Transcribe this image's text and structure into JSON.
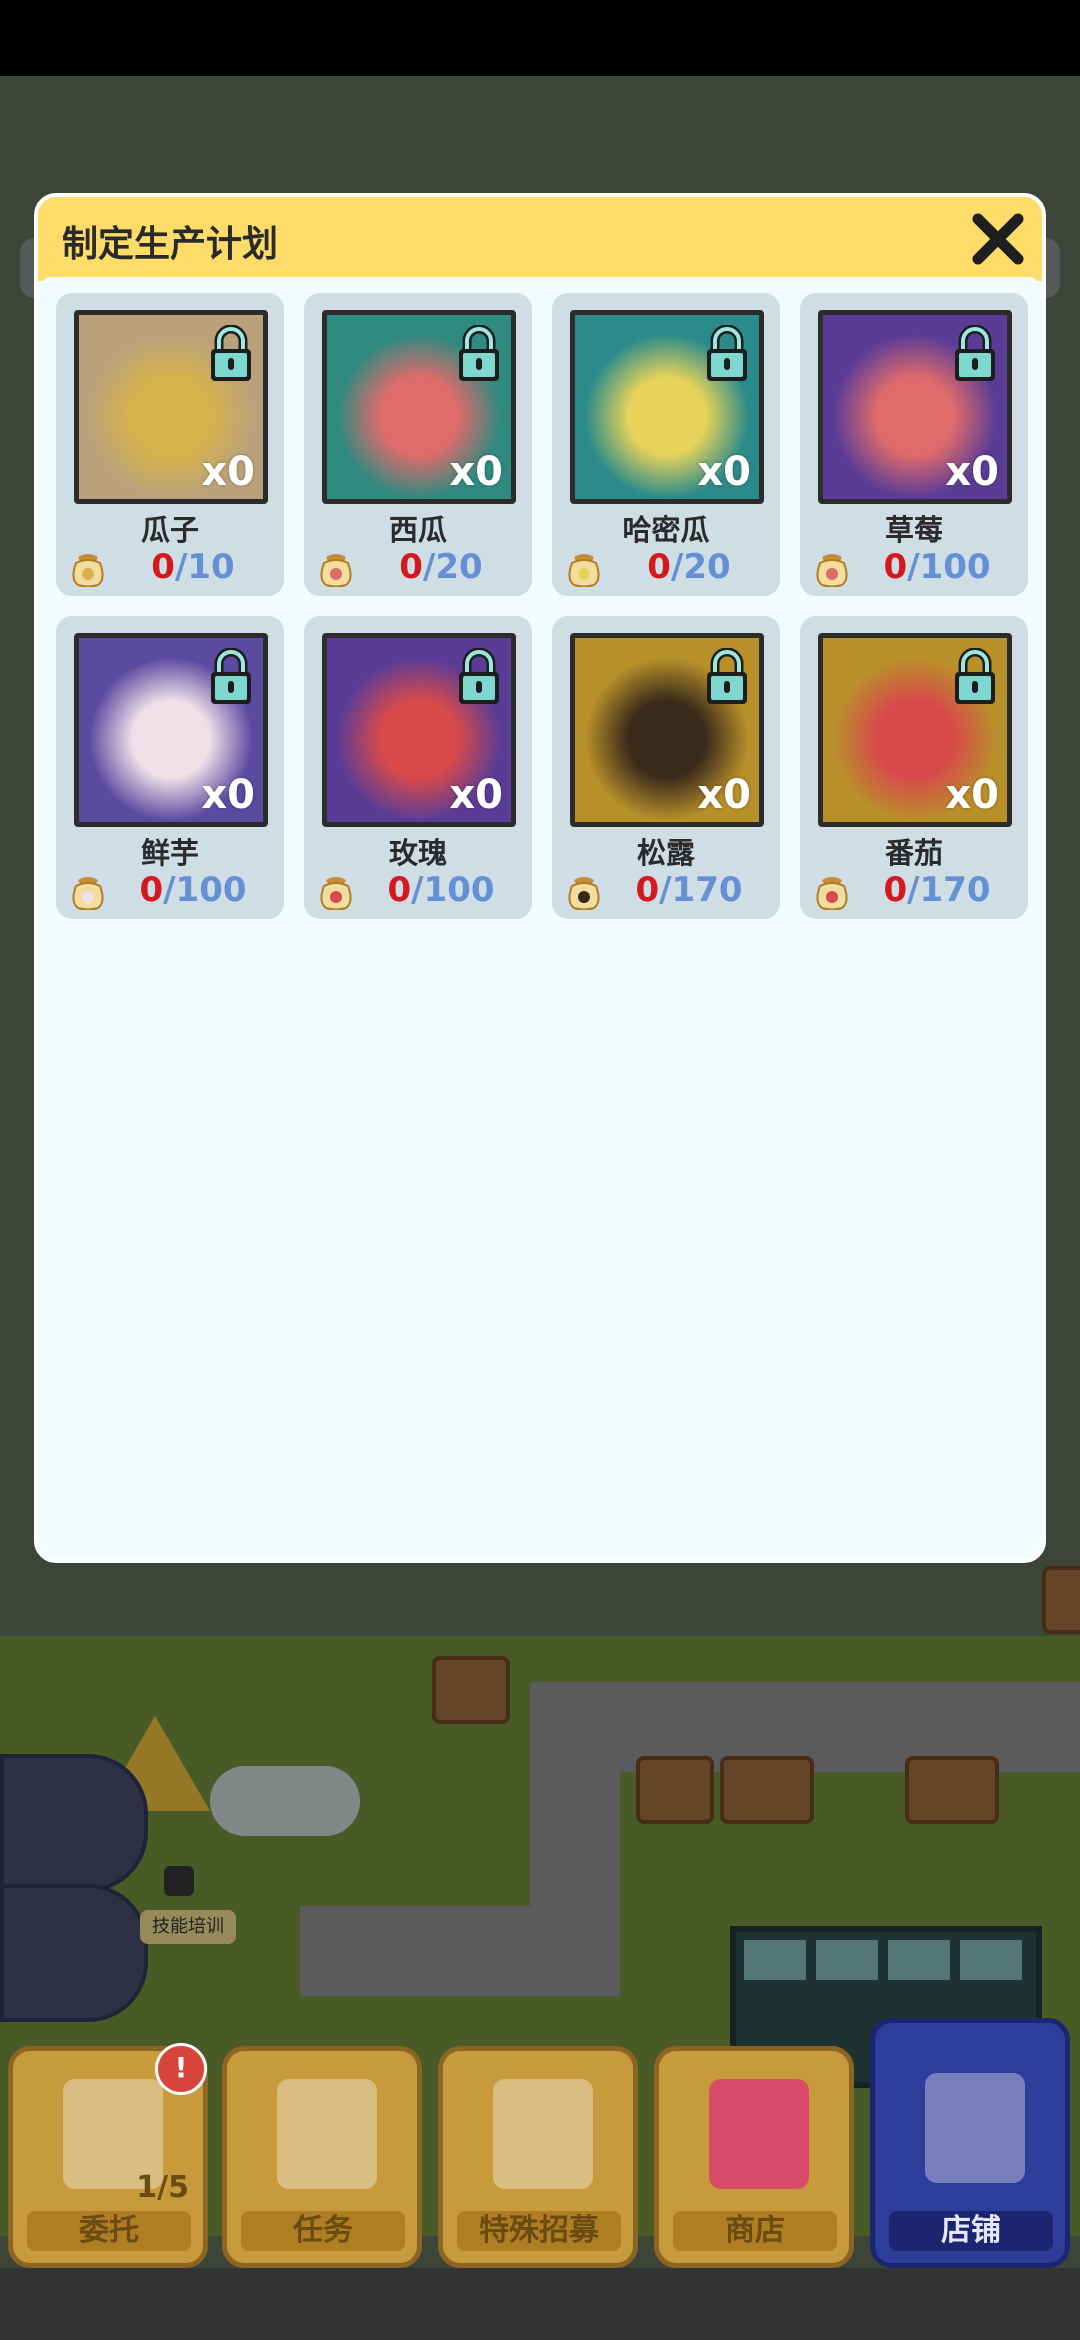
{
  "dialog": {
    "title": "制定生产计划"
  },
  "items": [
    {
      "name": "瓜子",
      "qty": "x0",
      "current": "0",
      "required": "/10",
      "bg": "#b9a27a",
      "seed_color": "#d8b24a"
    },
    {
      "name": "西瓜",
      "qty": "x0",
      "current": "0",
      "required": "/20",
      "bg": "#2f8a80",
      "seed_color": "#e06b6b"
    },
    {
      "name": "哈密瓜",
      "qty": "x0",
      "current": "0",
      "required": "/20",
      "bg": "#2b8b8a",
      "seed_color": "#e7d35a"
    },
    {
      "name": "草莓",
      "qty": "x0",
      "current": "0",
      "required": "/100",
      "bg": "#5a3c96",
      "seed_color": "#e06b6b"
    },
    {
      "name": "鲜芋",
      "qty": "x0",
      "current": "0",
      "required": "/100",
      "bg": "#5a4aa0",
      "seed_color": "#f0e0e8"
    },
    {
      "name": "玫瑰",
      "qty": "x0",
      "current": "0",
      "required": "/100",
      "bg": "#5a3c96",
      "seed_color": "#d84a4a"
    },
    {
      "name": "松露",
      "qty": "x0",
      "current": "0",
      "required": "/170",
      "bg": "#b8902a",
      "seed_color": "#3a2a1a"
    },
    {
      "name": "番茄",
      "qty": "x0",
      "current": "0",
      "required": "/170",
      "bg": "#b8902a",
      "seed_color": "#d84a4a"
    }
  ],
  "bottom_tabs": [
    {
      "label": "委托",
      "count": "1/5",
      "badge": "!"
    },
    {
      "label": "任务"
    },
    {
      "label": "特殊招募"
    },
    {
      "label": "商店"
    },
    {
      "label": "店铺"
    }
  ],
  "side": {
    "skill_label": "技能培训"
  },
  "icons": {
    "close": "close-icon",
    "lock": "lock-icon",
    "seed_bag": "seed-bag-icon"
  }
}
